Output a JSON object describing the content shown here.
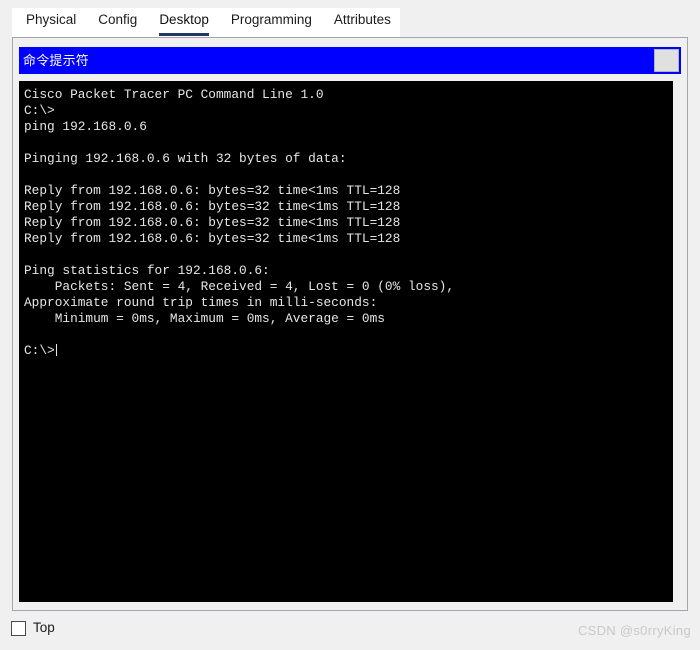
{
  "tabs": [
    {
      "label": "Physical",
      "active": false
    },
    {
      "label": "Config",
      "active": false
    },
    {
      "label": "Desktop",
      "active": true
    },
    {
      "label": "Programming",
      "active": false
    },
    {
      "label": "Attributes",
      "active": false
    }
  ],
  "window": {
    "title": "命令提示符",
    "close_button_label": ""
  },
  "terminal": {
    "lines": [
      "Cisco Packet Tracer PC Command Line 1.0",
      "C:\\>",
      "ping 192.168.0.6",
      "",
      "Pinging 192.168.0.6 with 32 bytes of data:",
      "",
      "Reply from 192.168.0.6: bytes=32 time<1ms TTL=128",
      "Reply from 192.168.0.6: bytes=32 time<1ms TTL=128",
      "Reply from 192.168.0.6: bytes=32 time<1ms TTL=128",
      "Reply from 192.168.0.6: bytes=32 time<1ms TTL=128",
      "",
      "Ping statistics for 192.168.0.6:",
      "    Packets: Sent = 4, Received = 4, Lost = 0 (0% loss),",
      "Approximate round trip times in milli-seconds:",
      "    Minimum = 0ms, Maximum = 0ms, Average = 0ms",
      ""
    ],
    "prompt": "C:\\>"
  },
  "bottom": {
    "top_checkbox_label": "Top",
    "top_checkbox_checked": false,
    "watermark": "CSDN @s0rryKing"
  },
  "colors": {
    "titlebar": "#0000ff",
    "terminal_bg": "#000000",
    "terminal_fg": "#e6e6e6",
    "active_tab_underline": "#1f3864",
    "page_bg": "#f0f0f0"
  }
}
